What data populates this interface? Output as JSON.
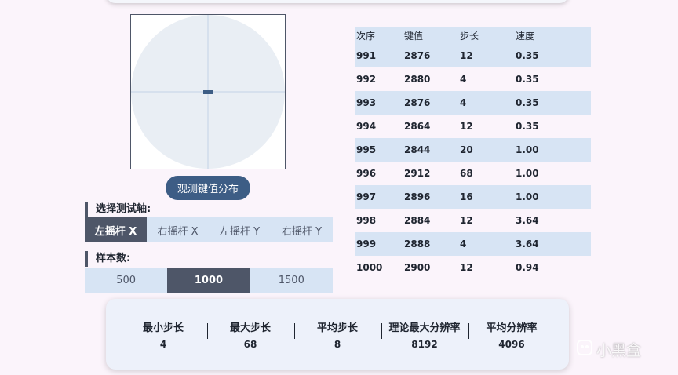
{
  "observe_button": "观测键值分布",
  "axis_section": {
    "label": "选择测试轴:",
    "options": [
      "左摇杆 X",
      "右摇杆 X",
      "左摇杆 Y",
      "右摇杆 Y"
    ],
    "selected": "左摇杆 X"
  },
  "sample_section": {
    "label": "样本数:",
    "options": [
      "500",
      "1000",
      "1500"
    ],
    "selected": "1000"
  },
  "table": {
    "headers": [
      "次序",
      "键值",
      "步长",
      "速度"
    ],
    "rows": [
      [
        "991",
        "2876",
        "12",
        "0.35"
      ],
      [
        "992",
        "2880",
        "4",
        "0.35"
      ],
      [
        "993",
        "2876",
        "4",
        "0.35"
      ],
      [
        "994",
        "2864",
        "12",
        "0.35"
      ],
      [
        "995",
        "2844",
        "20",
        "1.00"
      ],
      [
        "996",
        "2912",
        "68",
        "1.00"
      ],
      [
        "997",
        "2896",
        "16",
        "1.00"
      ],
      [
        "998",
        "2884",
        "12",
        "3.64"
      ],
      [
        "999",
        "2888",
        "4",
        "3.64"
      ],
      [
        "1000",
        "2900",
        "12",
        "0.94"
      ]
    ]
  },
  "stats": [
    {
      "label": "最小步长",
      "value": "4"
    },
    {
      "label": "最大步长",
      "value": "68"
    },
    {
      "label": "平均步长",
      "value": "8"
    },
    {
      "label": "理论最大分辨率",
      "value": "8192"
    },
    {
      "label": "平均分辨率",
      "value": "4096"
    }
  ],
  "watermark": "小黑盒",
  "colors": {
    "accent": "#3d5d85",
    "active_segment": "#4e5668",
    "segment_bg": "#d7e4f4",
    "circle_fill": "#e9eef4"
  }
}
